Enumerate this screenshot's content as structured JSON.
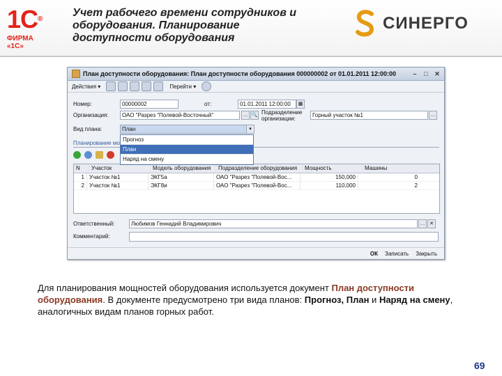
{
  "header": {
    "logo_1c_mark": "1С",
    "logo_1c_firma": "ФИРМА «1С»",
    "title_lines": [
      "Учет рабочего времени сотрудников и",
      "оборудования. Планирование",
      "доступности оборудования"
    ],
    "sinergo": "СИНЕРГО"
  },
  "window": {
    "title": "План доступности оборудования: План доступности оборудования 000000002 от 01.01.2011 12:00:00",
    "toolbar": {
      "actions": "Действия",
      "goto": "Перейти"
    },
    "fields": {
      "number_label": "Номер:",
      "number_value": "00000002",
      "date_label": "от:",
      "date_value": "01.01.2011 12:00:00",
      "org_label": "Организация:",
      "org_value": "ОАО \"Разрез \"Полевой-Восточный\"",
      "subdiv_label": "Подразделение организации:",
      "subdiv_value": "Горный участок №1",
      "plantype_label": "Вид плана:",
      "plantype_value": "План"
    },
    "dropdown_options": [
      "Прогноз",
      "План",
      "Наряд на смену"
    ],
    "dropdown_selected": 1,
    "tab_label": "Планирование мощ...",
    "grid": {
      "columns": [
        "N",
        "Участок",
        "Модель оборудования",
        "Подразделение оборудования",
        "Мощность",
        "Машины"
      ],
      "rows": [
        [
          "1",
          "Участок №1",
          "ЭКГ5а",
          "ОАО \"Разрез \"Полевой-Вос...",
          "150,000",
          "0"
        ],
        [
          "2",
          "Участок №1",
          "ЭКГ8и",
          "ОАО \"Разрез \"Полевой-Вос...",
          "110,000",
          "2"
        ]
      ]
    },
    "resp_label": "Ответственный:",
    "resp_value": "Любимов Геннадий Владимирович",
    "comment_label": "Комментарий:",
    "comment_value": "",
    "status": {
      "ok": "ОК",
      "save": "Записать",
      "close": "Закрыть"
    }
  },
  "description": {
    "p1": "Для планирования мощностей оборудования используется документ ",
    "hl": "План доступности оборудования",
    "p2": ". В документе предусмотрено три вида планов: ",
    "kinds": "Прогноз, План",
    "and": " и ",
    "kind3": "Наряд на смену",
    "p3": ", аналогичных видам планов горных работ."
  },
  "page_number": "69",
  "colors": {
    "accent_red": "#e2231a",
    "page_num": "#1e3a8a",
    "highlight": "#8a3a24",
    "selection": "#3e6fb8"
  }
}
